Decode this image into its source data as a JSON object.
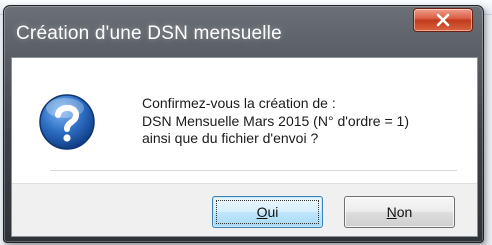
{
  "dialog": {
    "title": "Création d'une DSN mensuelle",
    "icon": "question-icon",
    "message_lines": [
      "Confirmez-vous la création de :",
      "DSN Mensuelle Mars 2015 (N° d'ordre = 1)",
      "ainsi que du fichier d'envoi ?"
    ]
  },
  "buttons": {
    "oui": {
      "mnemonic": "O",
      "rest": "ui"
    },
    "non": {
      "mnemonic": "N",
      "rest": "on"
    }
  },
  "close_button": {
    "icon": "close-icon"
  },
  "colors": {
    "titlebar": "#3d4248",
    "close_button": "#c13a1e",
    "question_icon": "#1f5fb0",
    "default_button_border": "#3c7fb1"
  }
}
